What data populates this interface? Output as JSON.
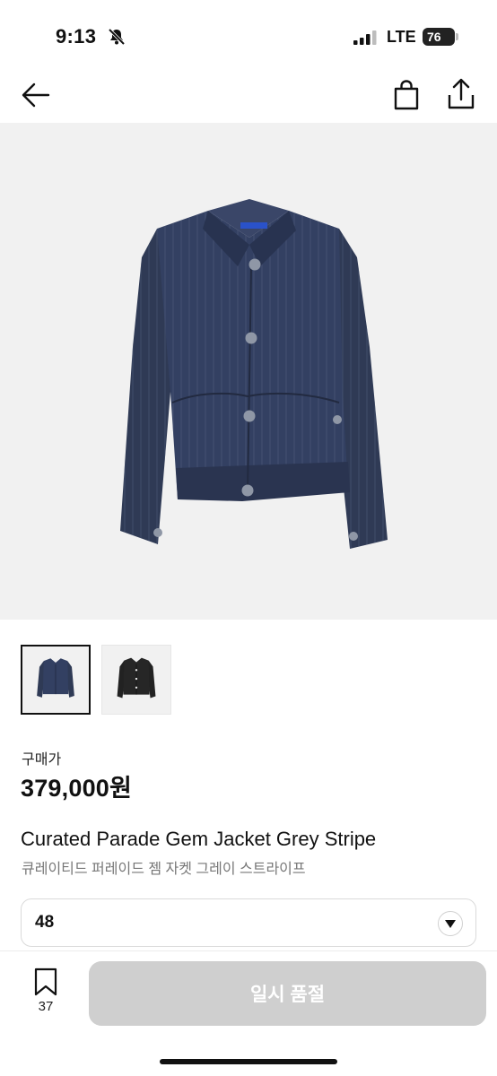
{
  "status": {
    "time": "9:13",
    "network": "LTE",
    "battery": "76",
    "icons": [
      "bell-off-icon",
      "signal-icon",
      "battery-icon"
    ]
  },
  "nav": {
    "icons": [
      "back-arrow-icon",
      "shopping-bag-icon",
      "share-icon"
    ]
  },
  "product": {
    "price_label": "구매가",
    "price": "379,000원",
    "name_en": "Curated Parade Gem Jacket Grey Stripe",
    "name_ko": "큐레이티드 퍼레이드 젬 자켓 그레이 스트라이프",
    "images": [
      "navy pinstripe jacket",
      "black jacket"
    ],
    "colors": {
      "hero_bg": "#f1f1f1",
      "jacket_navy": "#2f3a55",
      "jacket_black": "#222222"
    }
  },
  "size_select": {
    "value": "48",
    "icon": "caret-down-icon"
  },
  "bottom_bar": {
    "bookmark_count": "37",
    "bookmark_icon": "bookmark-icon",
    "button_label": "일시 품절",
    "button_color": "#cfcfcf"
  }
}
